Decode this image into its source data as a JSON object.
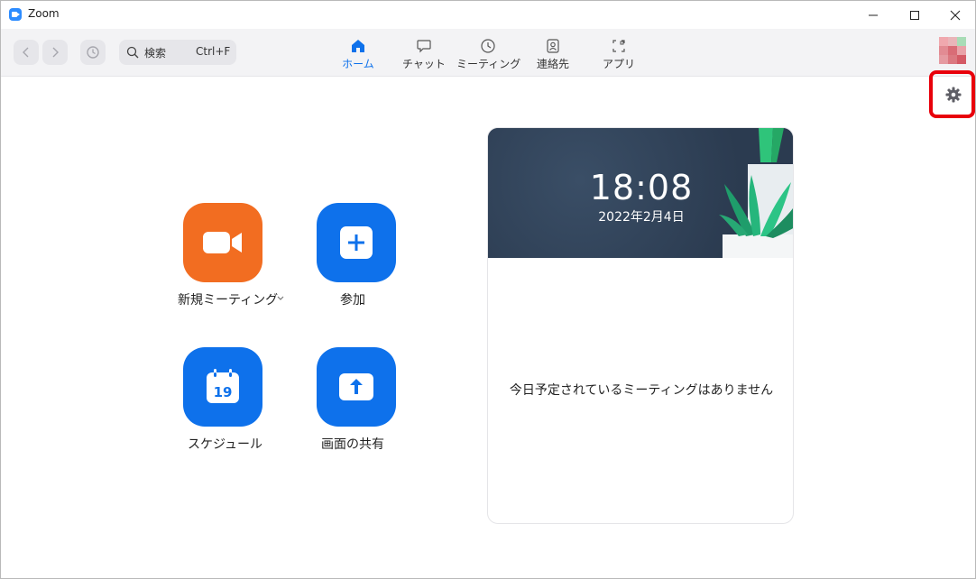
{
  "window": {
    "title": "Zoom"
  },
  "toolbar": {
    "search": {
      "label": "検索",
      "shortcut": "Ctrl+F"
    },
    "tabs": [
      {
        "id": "home",
        "label": "ホーム",
        "active": true
      },
      {
        "id": "chat",
        "label": "チャット",
        "active": false
      },
      {
        "id": "meetings",
        "label": "ミーティング",
        "active": false
      },
      {
        "id": "contacts",
        "label": "連絡先",
        "active": false
      },
      {
        "id": "apps",
        "label": "アプリ",
        "active": false
      }
    ]
  },
  "actions": {
    "new_meeting": "新規ミーティング",
    "join": "参加",
    "schedule": "スケジュール",
    "schedule_day": "19",
    "share_screen": "画面の共有"
  },
  "calendar": {
    "time": "18:08",
    "date": "2022年2月4日",
    "empty_message": "今日予定されているミーティングはありません"
  },
  "colors": {
    "accent": "#0e71eb",
    "new_meeting_orange": "#f26d21",
    "highlight_red": "#e8000b",
    "card_header": "#2f4157"
  },
  "icons": {
    "settings": "gear-icon",
    "back": "chevron-left-icon",
    "forward": "chevron-right-icon",
    "history": "history-icon",
    "search": "search-icon"
  }
}
